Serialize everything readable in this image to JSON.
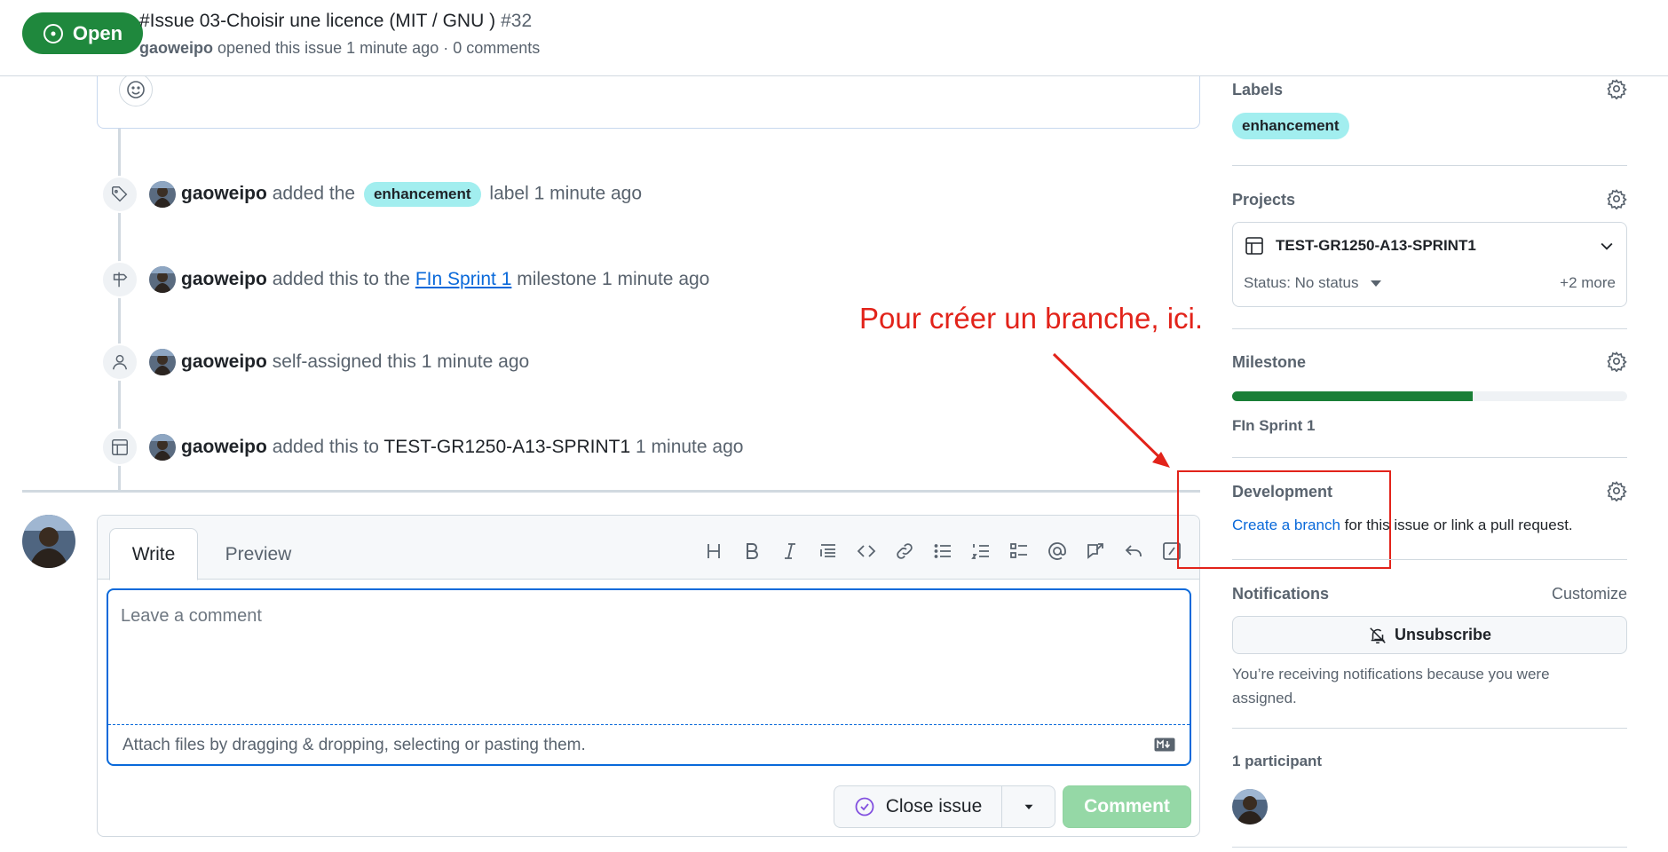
{
  "header": {
    "state": "Open",
    "title": "#Issue 03-Choisir une licence (MIT / GNU )",
    "number": "#32",
    "author": "gaoweipo",
    "meta": "opened this issue 1 minute ago · 0 comments"
  },
  "timeline": {
    "events": [
      {
        "actor": "gaoweipo",
        "pre": "added the",
        "label": "enhancement",
        "post": "label 1 minute ago",
        "icon": "tag-icon"
      },
      {
        "actor": "gaoweipo",
        "pre": "added this to the",
        "link": "FIn Sprint 1",
        "post": "milestone 1 minute ago",
        "icon": "milestone-icon"
      },
      {
        "actor": "gaoweipo",
        "pre": "self-assigned this 1 minute ago",
        "icon": "person-icon"
      },
      {
        "actor": "gaoweipo",
        "pre": "added this to",
        "strong": "TEST-GR1250-A13-SPRINT1",
        "post": "1 minute ago",
        "icon": "table-icon"
      }
    ]
  },
  "composer": {
    "tabs": [
      "Write",
      "Preview"
    ],
    "placeholder": "Leave a comment",
    "attach_text": "Attach files by dragging & dropping, selecting or pasting them.",
    "close_label": "Close issue",
    "comment_label": "Comment",
    "toolbar_icons": [
      "heading-icon",
      "bold-icon",
      "italic-icon",
      "quote-icon",
      "code-icon",
      "link-icon",
      "unordered-list-icon",
      "ordered-list-icon",
      "task-list-icon",
      "mention-icon",
      "cross-reference-icon",
      "reply-icon",
      "slash-commands-icon"
    ]
  },
  "annotation": {
    "text": "Pour créer un branche, ici."
  },
  "sidebar": {
    "labels": {
      "heading": "Labels",
      "label": "enhancement"
    },
    "projects": {
      "heading": "Projects",
      "name": "TEST-GR1250-A13-SPRINT1",
      "status": "Status: No status",
      "more": "+2 more"
    },
    "milestone": {
      "heading": "Milestone",
      "name": "FIn Sprint 1",
      "progress": 0.61
    },
    "development": {
      "heading": "Development",
      "link": "Create a branch",
      "rest": "for this issue or link a pull request."
    },
    "notifications": {
      "heading": "Notifications",
      "customize": "Customize",
      "button": "Unsubscribe",
      "note": "You’re receiving notifications because you were assigned."
    },
    "participants": {
      "heading": "1 participant"
    }
  },
  "colors": {
    "open_green": "#1f883d",
    "label_bg": "#a2eeef",
    "link_blue": "#0969da",
    "annotation_red": "#e2231a",
    "comment_button_disabled": "#95d8a6"
  }
}
